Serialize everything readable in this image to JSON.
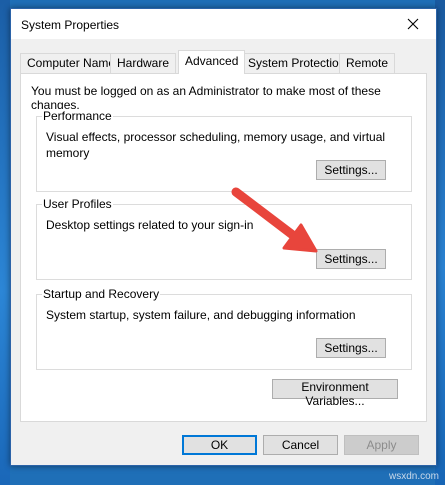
{
  "window": {
    "title": "System Properties"
  },
  "tabs": [
    {
      "label": "Computer Name",
      "active": false
    },
    {
      "label": "Hardware",
      "active": false
    },
    {
      "label": "Advanced",
      "active": true
    },
    {
      "label": "System Protection",
      "active": false
    },
    {
      "label": "Remote",
      "active": false
    }
  ],
  "advanced": {
    "notice": "You must be logged on as an Administrator to make most of these changes.",
    "performance": {
      "label": "Performance",
      "description": "Visual effects, processor scheduling, memory usage, and virtual memory",
      "button": "Settings..."
    },
    "user_profiles": {
      "label": "User Profiles",
      "description": "Desktop settings related to your sign-in",
      "button": "Settings..."
    },
    "startup_recovery": {
      "label": "Startup and Recovery",
      "description": "System startup, system failure, and debugging information",
      "button": "Settings..."
    },
    "env_vars_button": "Environment Variables..."
  },
  "dialog_buttons": {
    "ok": "OK",
    "cancel": "Cancel",
    "apply": "Apply"
  },
  "colors": {
    "arrow": "#e8453c",
    "accent": "#0078d7"
  },
  "watermark": "wsxdn.com"
}
